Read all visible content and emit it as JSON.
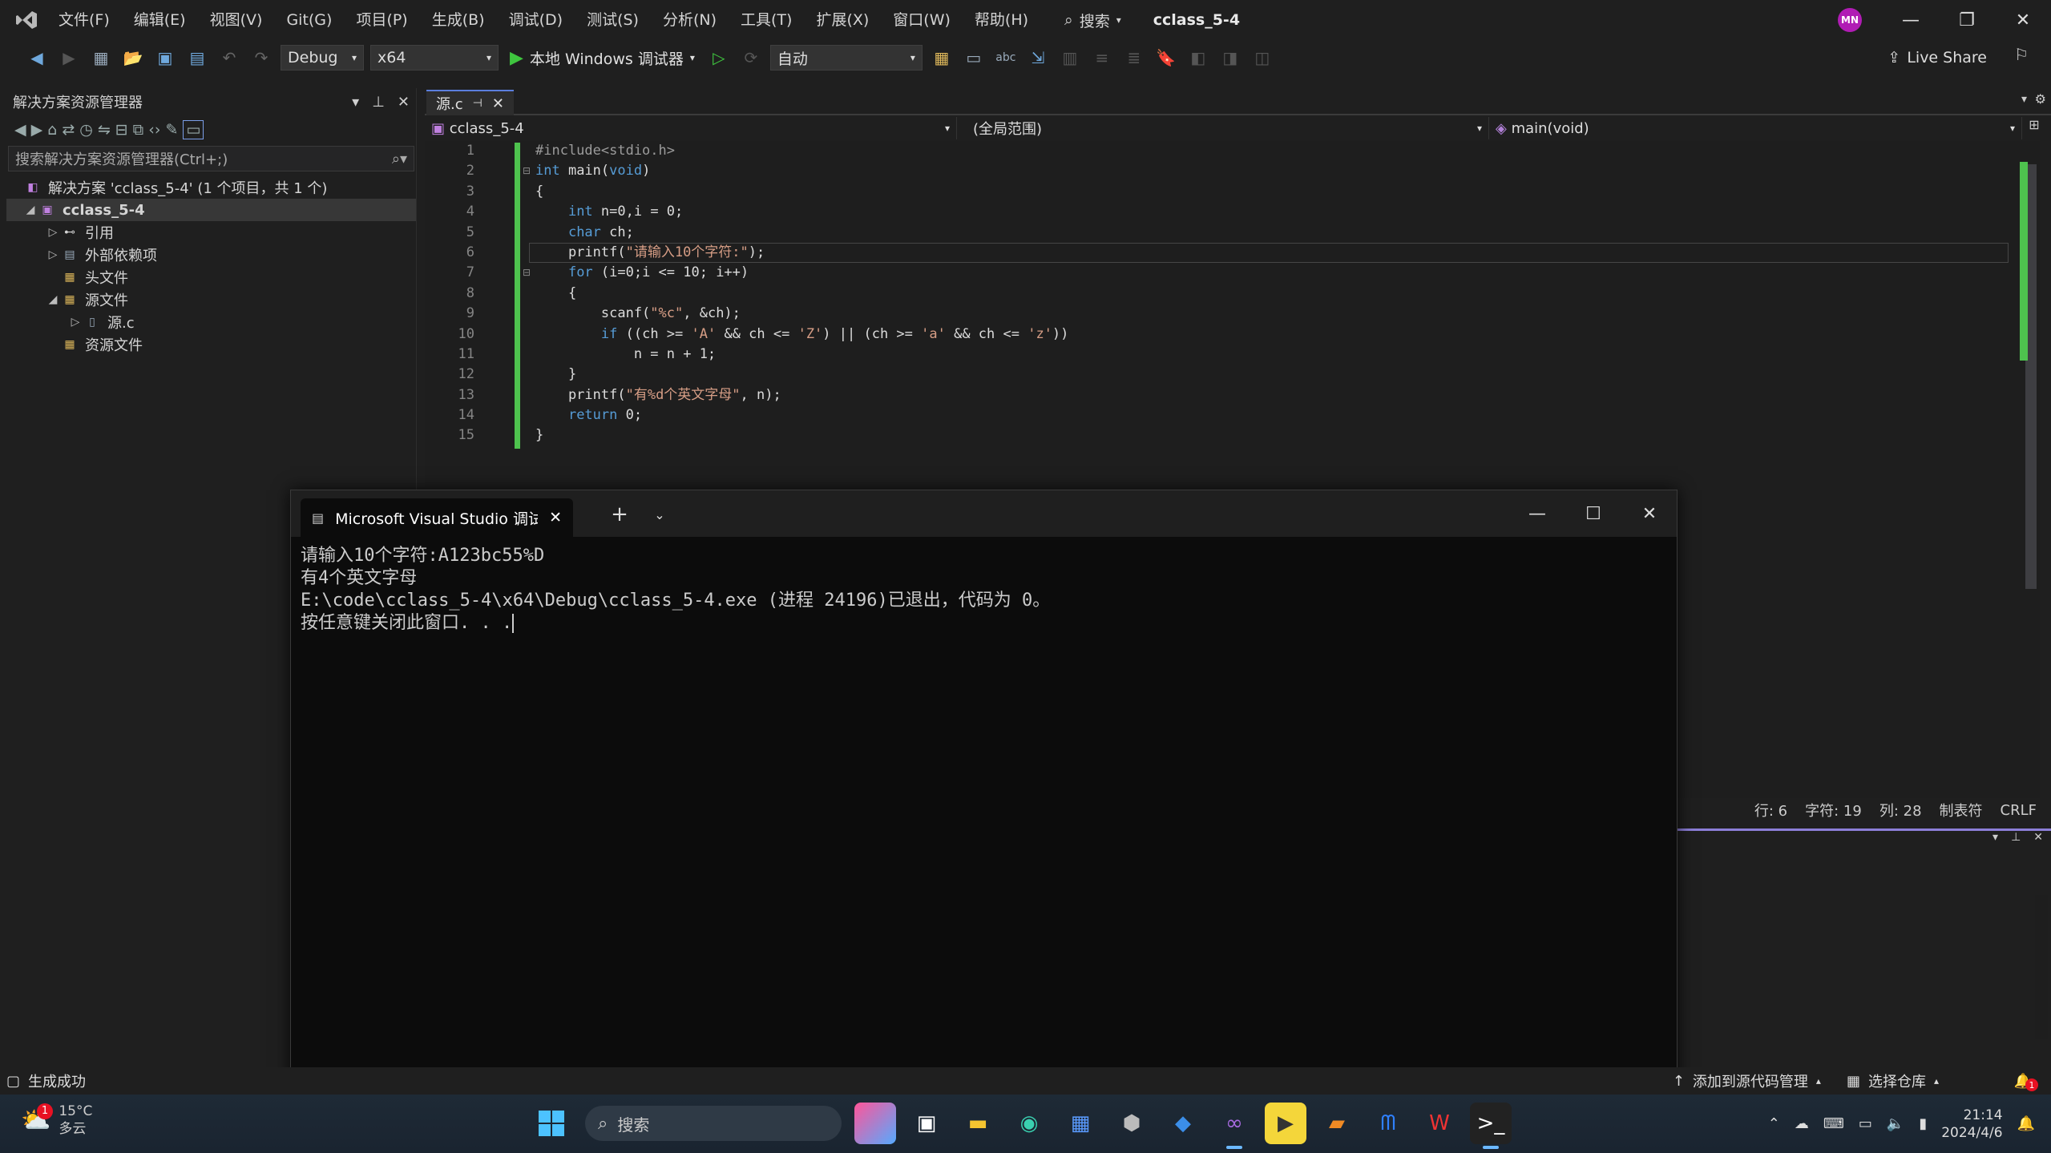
{
  "menu": {
    "items": [
      "文件(F)",
      "编辑(E)",
      "视图(V)",
      "Git(G)",
      "项目(P)",
      "生成(B)",
      "调试(D)",
      "测试(S)",
      "分析(N)",
      "工具(T)",
      "扩展(X)",
      "窗口(W)",
      "帮助(H)"
    ],
    "search_label": "搜索",
    "solution_name": "cclass_5-4",
    "avatar_initials": "MN"
  },
  "toolbar": {
    "config": "Debug",
    "platform": "x64",
    "run_label": "本地 Windows 调试器",
    "auto_label": "自动",
    "live_share": "Live Share"
  },
  "solution_explorer": {
    "title": "解决方案资源管理器",
    "search_placeholder": "搜索解决方案资源管理器(Ctrl+;)",
    "solution_line": "解决方案 'cclass_5-4' (1 个项目，共 1 个)",
    "project": "cclass_5-4",
    "nodes": [
      "引用",
      "外部依赖项",
      "头文件",
      "源文件",
      "源.c",
      "资源文件"
    ]
  },
  "editor": {
    "tab_label": "源.c",
    "nav_project": "cclass_5-4",
    "nav_scope": "(全局范围)",
    "nav_function": "main(void)",
    "line_numbers": [
      "1",
      "2",
      "3",
      "4",
      "5",
      "6",
      "7",
      "8",
      "9",
      "10",
      "11",
      "12",
      "13",
      "14",
      "15"
    ],
    "code": [
      "#include<stdio.h>",
      "int main(void)",
      "{",
      "    int n=0,i = 0;",
      "    char ch;",
      "    printf(\"请输入10个字符:\");",
      "    for (i=0;i <= 10; i++)",
      "    {",
      "        scanf(\"%c\", &ch);",
      "        if ((ch >= 'A' && ch <= 'Z') || (ch >= 'a' && ch <= 'z'))",
      "            n = n + 1;",
      "    }",
      "    printf(\"有%d个英文字母\", n);",
      "    return 0;",
      "}"
    ],
    "status": {
      "line": "行: 6",
      "char": "字符: 19",
      "col": "列: 28",
      "tabs": "制表符",
      "eol": "CRLF"
    }
  },
  "console": {
    "tab_title": "Microsoft Visual Studio 调试",
    "lines": [
      "请输入10个字符:A123bc55%D",
      "有4个英文字母",
      "E:\\code\\cclass_5-4\\x64\\Debug\\cclass_5-4.exe (进程 24196)已退出，代码为 0。",
      "按任意键关闭此窗口. . ."
    ]
  },
  "statusbar": {
    "build_status": "生成成功",
    "add_source": "添加到源代码管理",
    "select_repo": "选择仓库",
    "notification_count": "1"
  },
  "taskbar": {
    "weather_temp": "15°C",
    "weather_desc": "多云",
    "weather_badge": "1",
    "search_label": "搜索",
    "time": "21:14",
    "date": "2024/4/6"
  }
}
